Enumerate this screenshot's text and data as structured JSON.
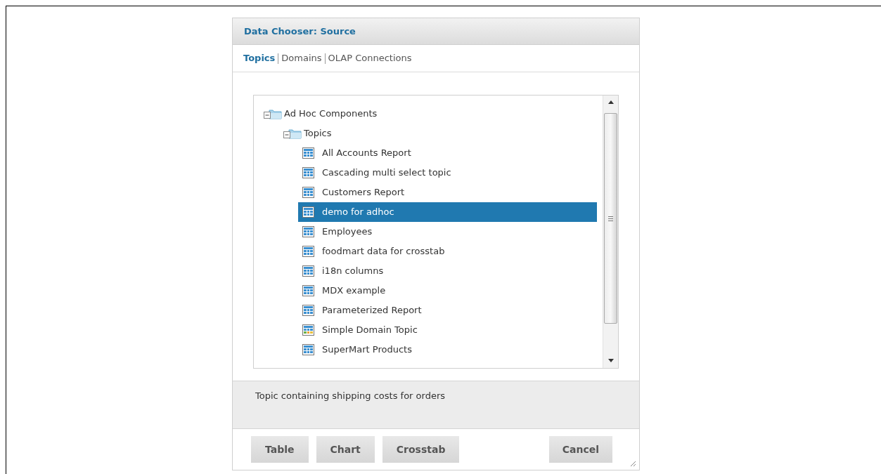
{
  "dialog": {
    "title": "Data Chooser: Source"
  },
  "tabs": [
    {
      "label": "Topics",
      "selected": true
    },
    {
      "label": "Domains",
      "selected": false
    },
    {
      "label": "OLAP Connections",
      "selected": false
    }
  ],
  "tree": [
    {
      "label": "Ad Hoc Components",
      "kind": "folder",
      "expanded": true,
      "children": [
        {
          "label": "Topics",
          "kind": "folder",
          "expanded": true,
          "children": [
            {
              "label": "All Accounts Report",
              "kind": "topic",
              "selected": false
            },
            {
              "label": "Cascading multi select topic",
              "kind": "topic",
              "selected": false
            },
            {
              "label": "Customers Report",
              "kind": "topic",
              "selected": false
            },
            {
              "label": "demo for adhoc",
              "kind": "topic",
              "selected": true
            },
            {
              "label": "Employees",
              "kind": "topic",
              "selected": false
            },
            {
              "label": "foodmart data for crosstab",
              "kind": "topic",
              "selected": false
            },
            {
              "label": "i18n columns",
              "kind": "topic",
              "selected": false
            },
            {
              "label": "MDX example",
              "kind": "topic",
              "selected": false
            },
            {
              "label": "Parameterized Report",
              "kind": "topic",
              "selected": false
            },
            {
              "label": "Simple Domain Topic",
              "kind": "domain",
              "selected": false
            },
            {
              "label": "SuperMart Products",
              "kind": "topic",
              "selected": false
            }
          ]
        }
      ]
    }
  ],
  "description": "Topic containing shipping costs for orders",
  "buttons": [
    "Table",
    "Chart",
    "Crosstab"
  ],
  "cancel_button": "Cancel"
}
